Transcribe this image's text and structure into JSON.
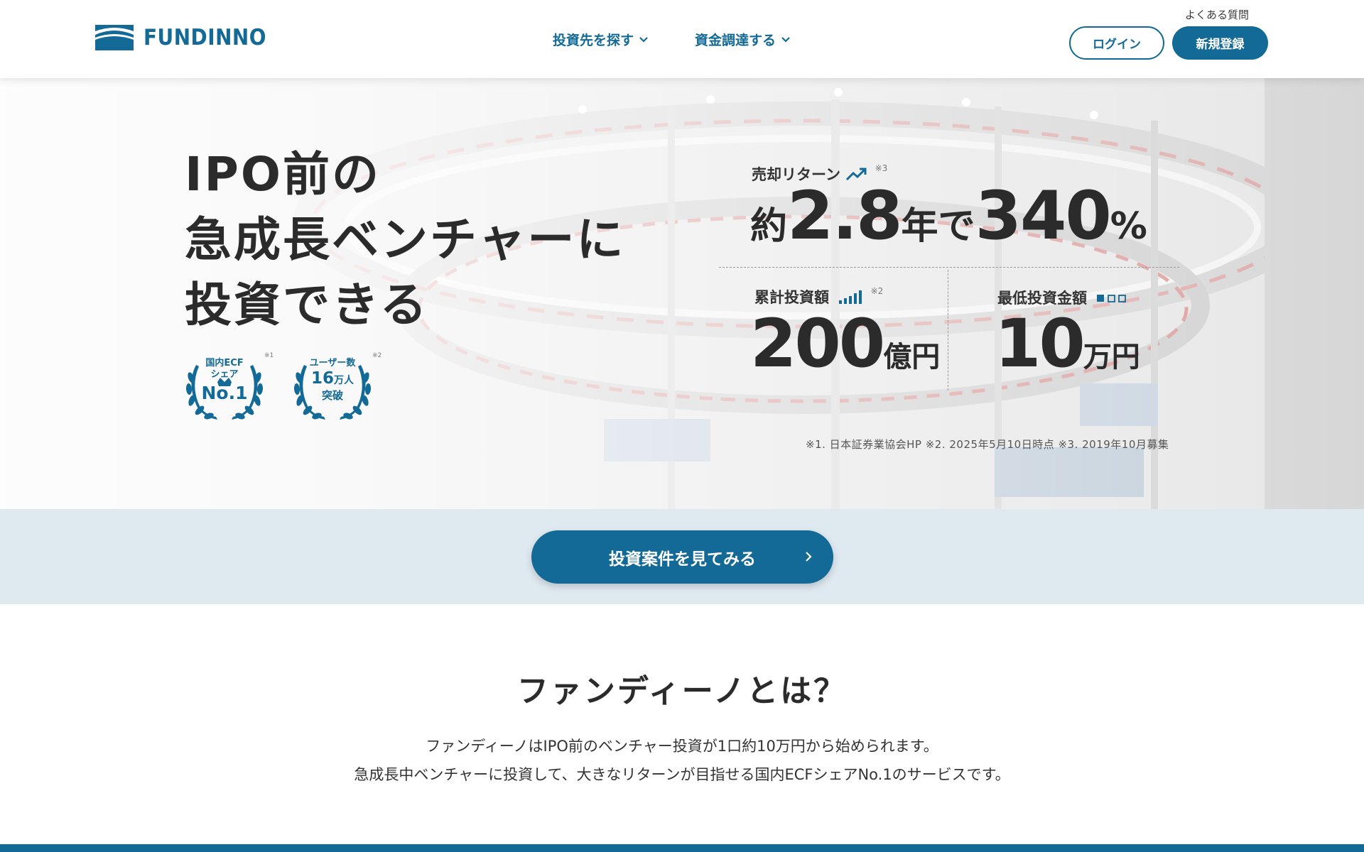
{
  "header": {
    "logo_text": "FUNDINNO",
    "nav": [
      {
        "label": "投資先を探す"
      },
      {
        "label": "資金調達する"
      }
    ],
    "faq_label": "よくある質問",
    "login_label": "ログイン",
    "signup_label": "新規登録"
  },
  "hero": {
    "title_lines": [
      "IPO前の",
      "急成長ベンチャーに",
      "投資できる"
    ],
    "badges": [
      {
        "line1": "国内ECF",
        "line2": "シェア",
        "big": "No.1",
        "note": "※1"
      },
      {
        "line1": "ユーザー数",
        "big": "16",
        "big_suffix": "万人",
        "line3": "突破",
        "note": "※2"
      }
    ],
    "stats": {
      "return": {
        "label": "売却リターン",
        "note": "※3",
        "prefix": "約",
        "years": "2.8",
        "years_unit": "年で",
        "percent": "340",
        "percent_unit": "%"
      },
      "total": {
        "label": "累計投資額",
        "note": "※2",
        "value": "200",
        "unit": "億円"
      },
      "minimum": {
        "label": "最低投資金額",
        "value": "10",
        "unit": "万円"
      }
    },
    "footnotes": "※1. 日本証券業協会HP ※2. 2025年5月10日時点 ※3. 2019年10月募集"
  },
  "cta": {
    "label": "投資案件を見てみる"
  },
  "about": {
    "title": "ファンディーノとは？",
    "lines": [
      "ファンディーノはIPO前のベンチャー投資が1口約10万円から始められます。",
      "急成長中ベンチャーに投資して、大きなリターンが目指せる国内ECFシェアNo.1のサービスです。"
    ]
  },
  "colors": {
    "brand": "#136a96",
    "cta_band": "#dfe9f0",
    "text": "#2b2b2b"
  }
}
